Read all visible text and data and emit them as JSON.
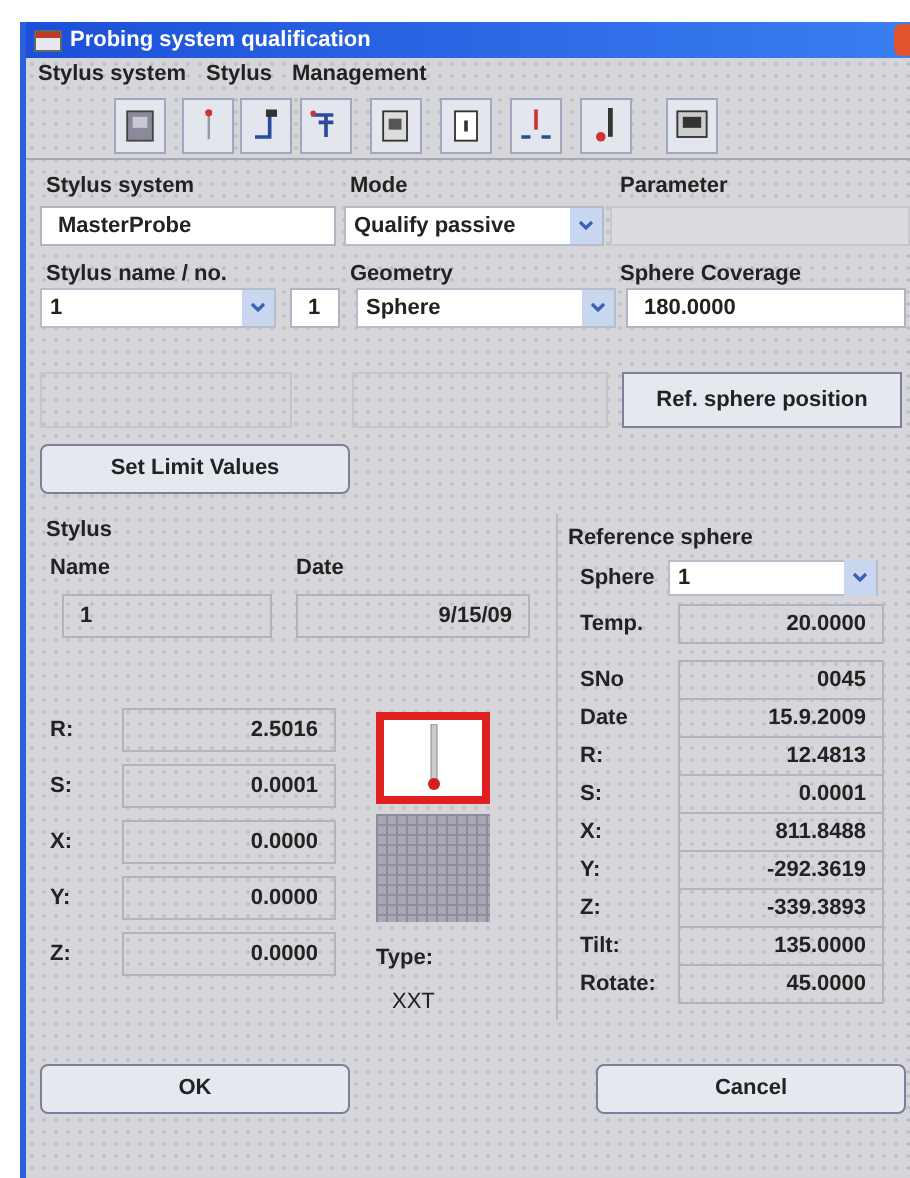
{
  "window": {
    "title": "Probing system qualification"
  },
  "menu": [
    "Stylus system",
    "Stylus",
    "Management"
  ],
  "stylus_system": {
    "label": "Stylus system",
    "value": "MasterProbe"
  },
  "mode": {
    "label": "Mode",
    "value": "Qualify passive"
  },
  "parameter": {
    "label": "Parameter",
    "disabled": true
  },
  "stylus_name": {
    "label": "Stylus name / no.",
    "value": "1",
    "number": "1"
  },
  "geometry": {
    "label": "Geometry",
    "value": "Sphere"
  },
  "sphere_coverage": {
    "label": "Sphere Coverage",
    "value": "180.0000"
  },
  "action_buttons": [
    {
      "disabled": true
    },
    {
      "disabled": true
    },
    {
      "label": "Ref. sphere position",
      "disabled": false
    }
  ],
  "set_limit_button": "Set Limit Values",
  "stylus": {
    "title": "Stylus",
    "name_label": "Name",
    "date_label": "Date",
    "name": "1",
    "date": "9/15/09",
    "type_label": "Type:",
    "type": "XXT",
    "values": [
      {
        "label": "R:",
        "value": "2.5016"
      },
      {
        "label": "S:",
        "value": "0.0001"
      },
      {
        "label": "X:",
        "value": "0.0000"
      },
      {
        "label": "Y:",
        "value": "0.0000"
      },
      {
        "label": "Z:",
        "value": "0.0000"
      }
    ]
  },
  "reference_sphere": {
    "title": "Reference sphere",
    "sphere_label": "Sphere",
    "sphere": "1",
    "temp_label": "Temp.",
    "temp": "20.0000",
    "values": [
      {
        "label": "SNo",
        "value": "0045"
      },
      {
        "label": "Date",
        "value": "15.9.2009"
      },
      {
        "label": "R:",
        "value": "12.4813"
      },
      {
        "label": "S:",
        "value": "0.0001"
      },
      {
        "label": "X:",
        "value": "811.8488"
      },
      {
        "label": "Y:",
        "value": "-292.3619"
      },
      {
        "label": "Z:",
        "value": "-339.3893"
      },
      {
        "label": "Tilt:",
        "value": "135.0000"
      },
      {
        "label": "Rotate:",
        "value": "45.0000"
      }
    ]
  },
  "buttons": [
    "OK",
    "Cancel"
  ]
}
